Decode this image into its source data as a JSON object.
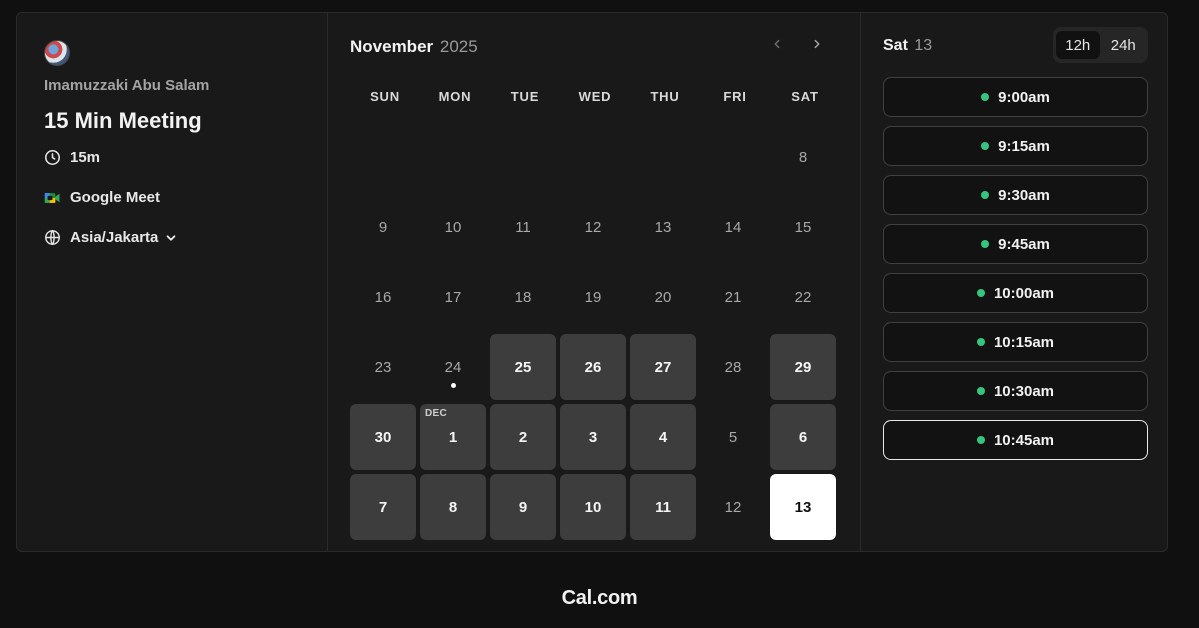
{
  "profile": {
    "host_name": "Imamuzzaki Abu Salam",
    "event_title": "15 Min Meeting",
    "duration": "15m",
    "location": "Google Meet",
    "timezone": "Asia/Jakarta"
  },
  "calendar": {
    "month": "November",
    "year": "2025",
    "weekdays": [
      "SUN",
      "MON",
      "TUE",
      "WED",
      "THU",
      "FRI",
      "SAT"
    ],
    "weeks": [
      [
        {
          "day": ""
        },
        {
          "day": ""
        },
        {
          "day": ""
        },
        {
          "day": ""
        },
        {
          "day": ""
        },
        {
          "day": ""
        },
        {
          "day": "8",
          "state": "unavailable"
        }
      ],
      [
        {
          "day": "9",
          "state": "unavailable"
        },
        {
          "day": "10",
          "state": "unavailable"
        },
        {
          "day": "11",
          "state": "unavailable"
        },
        {
          "day": "12",
          "state": "unavailable"
        },
        {
          "day": "13",
          "state": "unavailable"
        },
        {
          "day": "14",
          "state": "unavailable"
        },
        {
          "day": "15",
          "state": "unavailable"
        }
      ],
      [
        {
          "day": "16",
          "state": "unavailable"
        },
        {
          "day": "17",
          "state": "unavailable"
        },
        {
          "day": "18",
          "state": "unavailable"
        },
        {
          "day": "19",
          "state": "unavailable"
        },
        {
          "day": "20",
          "state": "unavailable"
        },
        {
          "day": "21",
          "state": "unavailable"
        },
        {
          "day": "22",
          "state": "unavailable"
        }
      ],
      [
        {
          "day": "23",
          "state": "unavailable"
        },
        {
          "day": "24",
          "state": "unavailable",
          "today": true
        },
        {
          "day": "25",
          "state": "available"
        },
        {
          "day": "26",
          "state": "available"
        },
        {
          "day": "27",
          "state": "available"
        },
        {
          "day": "28",
          "state": "unavailable"
        },
        {
          "day": "29",
          "state": "available"
        }
      ],
      [
        {
          "day": "30",
          "state": "available"
        },
        {
          "day": "1",
          "state": "available",
          "month_tag": "DEC"
        },
        {
          "day": "2",
          "state": "available"
        },
        {
          "day": "3",
          "state": "available"
        },
        {
          "day": "4",
          "state": "available"
        },
        {
          "day": "5",
          "state": "unavailable"
        },
        {
          "day": "6",
          "state": "available"
        }
      ],
      [
        {
          "day": "7",
          "state": "available"
        },
        {
          "day": "8",
          "state": "available"
        },
        {
          "day": "9",
          "state": "available"
        },
        {
          "day": "10",
          "state": "available"
        },
        {
          "day": "11",
          "state": "available"
        },
        {
          "day": "12",
          "state": "unavailable"
        },
        {
          "day": "13",
          "state": "selected"
        }
      ]
    ]
  },
  "slots_panel": {
    "weekday": "Sat",
    "date": "13",
    "format_options": [
      "12h",
      "24h"
    ],
    "active_format": "12h",
    "slots": [
      "9:00am",
      "9:15am",
      "9:30am",
      "9:45am",
      "10:00am",
      "10:15am",
      "10:30am",
      "10:45am"
    ],
    "highlighted_slot": "10:45am",
    "dot_color": "#35c67d"
  },
  "footer": {
    "brand": "Cal.com"
  }
}
